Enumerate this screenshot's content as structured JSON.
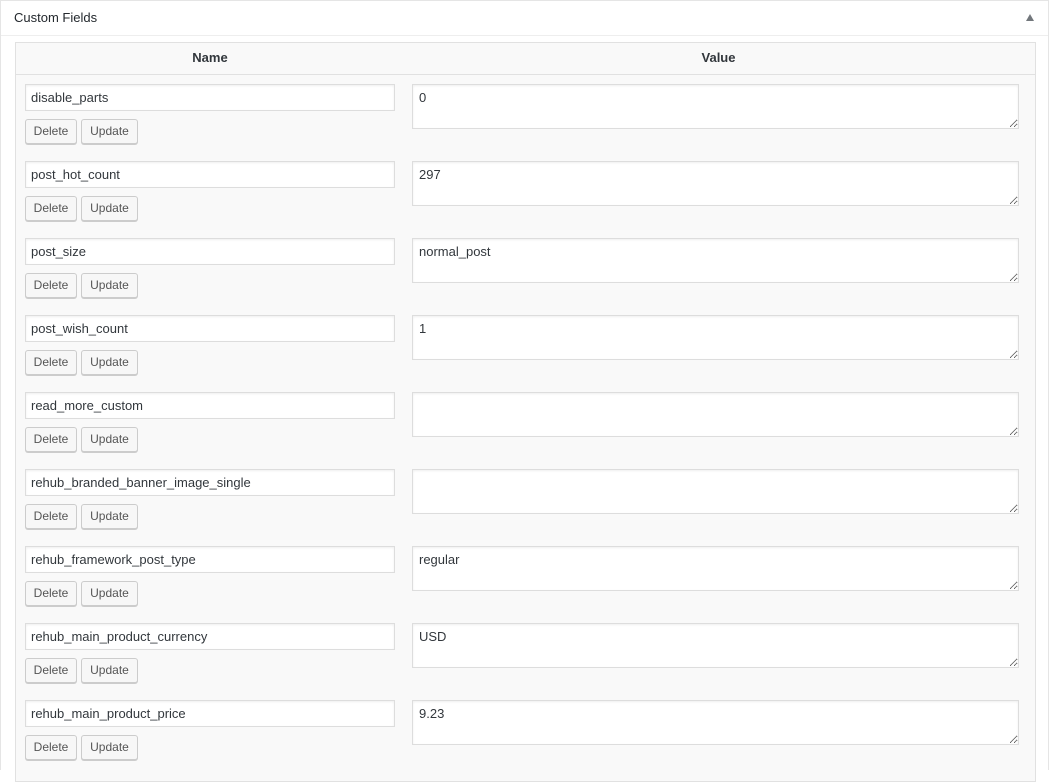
{
  "metabox": {
    "title": "Custom Fields"
  },
  "table": {
    "header_name": "Name",
    "header_value": "Value",
    "delete_label": "Delete",
    "update_label": "Update"
  },
  "fields": [
    {
      "name": "disable_parts",
      "value": "0"
    },
    {
      "name": "post_hot_count",
      "value": "297"
    },
    {
      "name": "post_size",
      "value": "normal_post"
    },
    {
      "name": "post_wish_count",
      "value": "1"
    },
    {
      "name": "read_more_custom",
      "value": ""
    },
    {
      "name": "rehub_branded_banner_image_single",
      "value": ""
    },
    {
      "name": "rehub_framework_post_type",
      "value": "regular"
    },
    {
      "name": "rehub_main_product_currency",
      "value": "USD"
    },
    {
      "name": "rehub_main_product_price",
      "value": "9.23"
    }
  ]
}
